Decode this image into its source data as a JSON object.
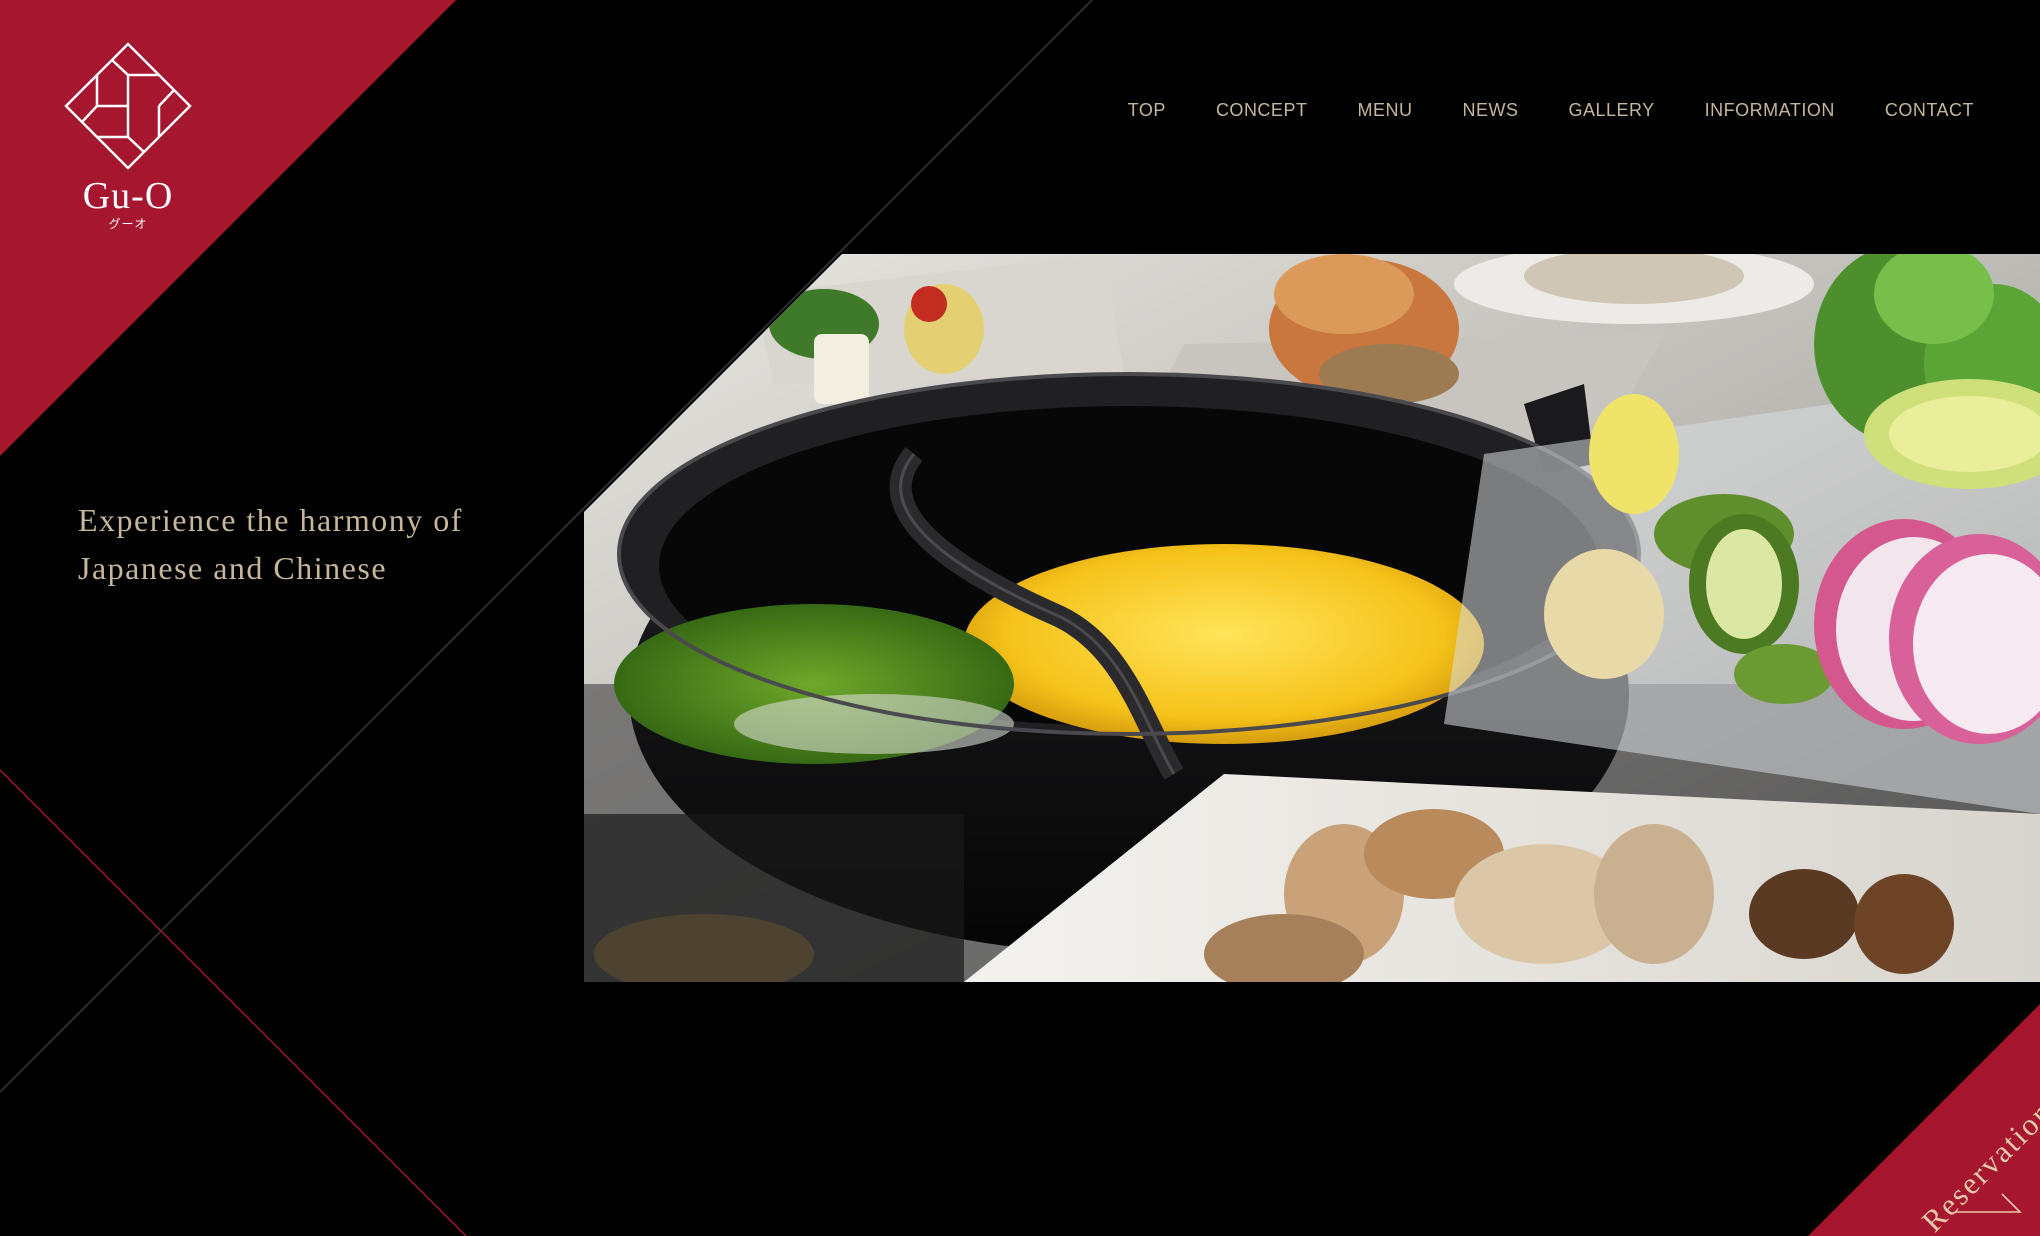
{
  "brand": {
    "name": "Gu-O",
    "kana": "グーオ",
    "accent_color": "#a6162f",
    "text_color": "#c6b79b"
  },
  "nav": {
    "items": [
      {
        "label": "TOP"
      },
      {
        "label": "CONCEPT"
      },
      {
        "label": "MENU"
      },
      {
        "label": "NEWS"
      },
      {
        "label": "GALLERY"
      },
      {
        "label": "INFORMATION"
      },
      {
        "label": "CONTACT"
      }
    ]
  },
  "hero": {
    "tagline_line1": "Experience the harmony of",
    "tagline_line2": "Japanese and Chinese",
    "image": "hot-pot-with-vegetables-and-mushrooms"
  },
  "reservation": {
    "label": "Reservation",
    "icon": "arrow-up-right-icon"
  }
}
